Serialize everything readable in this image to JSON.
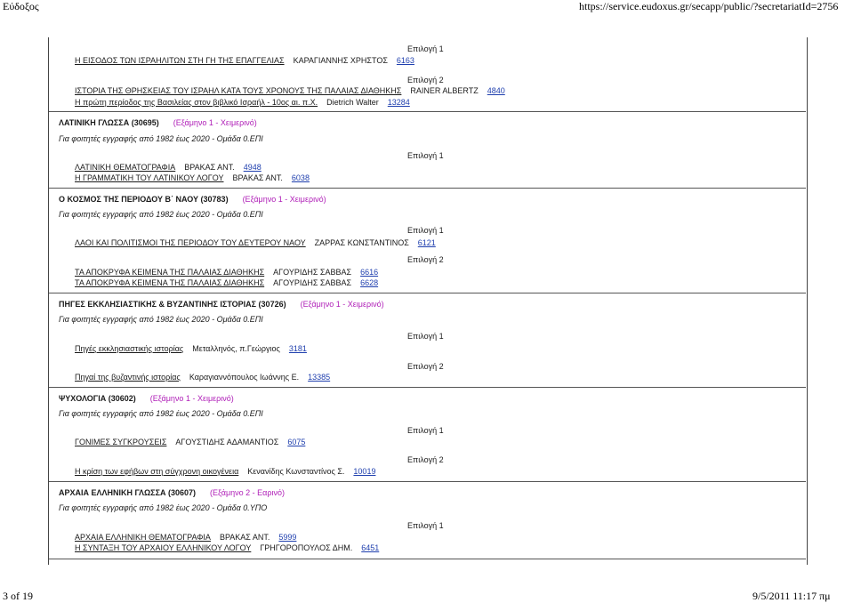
{
  "header": {
    "left": "Εύδοξος",
    "right": "https://service.eudoxus.gr/secapp/public/?secretariatId=2756"
  },
  "footer": {
    "left": "3 of 19",
    "right": "9/5/2011 11:17 πμ"
  },
  "choices": {
    "c1": "Επιλογή 1",
    "c2": "Επιλογή 2"
  },
  "courses": [
    {
      "title": "ΛΑΤΙΝΙΚΗ ΓΛΩΣΣΑ (30695)",
      "semester": "(Εξάμηνο 1 - Χειμερινό)",
      "note": "Για φοιτητές εγγραφής από 1982 έως 2020 - Ομάδα 0.ΕΠΙ",
      "books": [
        {
          "title": "ΛΑΤΙΝΙΚΗ ΘΕΜΑΤΟΓΡΑΦΙΑ",
          "author": "ΒΡΑΚΑΣ ΑΝΤ.",
          "code": "4948"
        },
        {
          "title": "Η ΓΡΑΜΜΑΤΙΚΗ ΤΟΥ ΛΑΤΙΝΙΚΟΥ ΛΟΓΟΥ",
          "author": "ΒΡΑΚΑΣ ΑΝΤ.",
          "code": "6038"
        }
      ]
    },
    {
      "title": "Ο ΚΟΣΜΟΣ ΤΗΣ ΠΕΡΙΟΔΟΥ Β΄ ΝΑΟΥ (30783)",
      "semester": "(Εξάμηνο 1 - Χειμερινό)",
      "note": "Για φοιτητές εγγραφής από 1982 έως 2020 - Ομάδα 0.ΕΠΙ",
      "books": [
        {
          "title": "ΛΑΟΙ ΚΑΙ ΠΟΛΙΤΙΣΜΟΙ ΤΗΣ ΠΕΡΙΟΔΟΥ ΤΟΥ ΔΕΥΤΕΡΟΥ ΝΑΟΥ",
          "author": "ΖΑΡΡΑΣ ΚΩΝΣΤΑΝΤΙΝΟΣ",
          "code": "6121"
        },
        {
          "title": "ΤΑ ΑΠΟΚΡΥΦΑ ΚΕΙΜΕΝΑ ΤΗΣ ΠΑΛΑΙΑΣ ΔΙΑΘΗΚΗΣ",
          "author": "ΑΓΟΥΡΙΔΗΣ ΣΑΒΒΑΣ",
          "code": "6616"
        },
        {
          "title": "ΤΑ ΑΠΟΚΡΥΦΑ ΚΕΙΜΕΝΑ ΤΗΣ ΠΑΛΑΙΑΣ ΔΙΑΘΗΚΗΣ",
          "author": "ΑΓΟΥΡΙΔΗΣ ΣΑΒΒΑΣ",
          "code": "6628"
        }
      ]
    },
    {
      "title": "ΠΗΓΕΣ ΕΚΚΛΗΣΙΑΣΤΙΚΗΣ & ΒΥΖΑΝΤΙΝΗΣ ΙΣΤΟΡΙΑΣ (30726)",
      "semester": "(Εξάμηνο 1 - Χειμερινό)",
      "note": "Για φοιτητές εγγραφής από 1982 έως 2020 - Ομάδα 0.ΕΠΙ",
      "books": [
        {
          "title": "Πηγές εκκλησιαστικής ιστορίας",
          "author": "Μεταλληνός, π.Γεώργιος",
          "code": "3181"
        },
        {
          "title": "Πηγαί της βυζαντινής ιστορίας",
          "author": "Καραγιαννόπουλος Ιωάννης Ε.",
          "code": "13385"
        }
      ]
    },
    {
      "title": "ΨΥΧΟΛΟΓΙΑ (30602)",
      "semester": "(Εξάμηνο 1 - Χειμερινό)",
      "note": "Για φοιτητές εγγραφής από 1982 έως 2020 - Ομάδα 0.ΕΠΙ",
      "books": [
        {
          "title": "ΓΟΝΙΜΕΣ ΣΥΓΚΡΟΥΣΕΙΣ",
          "author": "ΑΓΟΥΣΤΙΔΗΣ ΑΔΑΜΑΝΤΙΟΣ",
          "code": "6075"
        },
        {
          "title": "Η κρίση των εφήβων στη σύγχρονη οικογένεια",
          "author": "Κενανίδης Κωνσταντίνος Σ.",
          "code": "10019"
        }
      ]
    },
    {
      "title": "ΑΡΧΑΙΑ ΕΛΛΗΝΙΚΗ ΓΛΩΣΣΑ (30607)",
      "semester": "(Εξάμηνο 2 - Εαρινό)",
      "note": "Για φοιτητές εγγραφής από 1982 έως 2020 - Ομάδα 0.ΥΠΟ",
      "books": [
        {
          "title": "ΑΡΧΑΙΑ ΕΛΛΗΝΙΚΗ ΘΕΜΑΤΟΓΡΑΦΙΑ",
          "author": "ΒΡΑΚΑΣ ΑΝΤ.",
          "code": "5999"
        },
        {
          "title": "Η ΣΥΝΤΑΞΗ ΤΟΥ ΑΡΧΑΙΟΥ ΕΛΛΗΝΙΚΟΥ ΛΟΓΟΥ",
          "author": "ΓΡΗΓΟΡΟΠΟΥΛΟΣ ΔΗΜ.",
          "code": "6451"
        }
      ]
    }
  ],
  "top_books": [
    {
      "title": "Η ΕΙΣΟΔΟΣ ΤΩΝ ΙΣΡΑΗΛΙΤΩΝ ΣΤΗ ΓΗ ΤΗΣ ΕΠΑΓΓΕΛΙΑΣ",
      "author": "ΚΑΡΑΓΙΑΝΝΗΣ ΧΡΗΣΤΟΣ",
      "code": "6163"
    },
    {
      "title": "ΙΣΤΟΡΙΑ ΤΗΣ ΘΡΗΣΚΕΙΑΣ ΤΟΥ ΙΣΡΑΗΛ ΚΑΤΑ ΤΟΥΣ ΧΡΟΝΟΥΣ ΤΗΣ ΠΑΛΑΙΑΣ ΔΙΑΘΗΚΗΣ",
      "author": "RAINER ALBERTZ",
      "code": "4840"
    },
    {
      "title": "Η πρώτη περίοδος της Βασιλείας στον βιβλικό Ισραήλ - 10ος αι. π.Χ.",
      "author": "Dietrich Walter",
      "code": "13284"
    }
  ]
}
